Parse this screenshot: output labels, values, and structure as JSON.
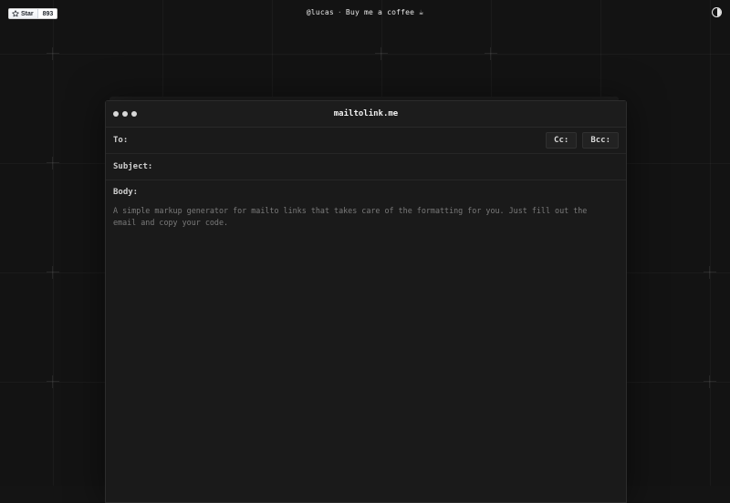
{
  "github": {
    "star_label": "Star",
    "star_count": "893",
    "icon": "star-icon"
  },
  "header": {
    "author": "@lucas",
    "separator": "·",
    "coffee": "Buy me a coffee ☕"
  },
  "theme_toggle": {
    "icon": "contrast-icon"
  },
  "window": {
    "title": "mailtolink.me",
    "to": {
      "label": "To:",
      "value": "",
      "placeholder": ""
    },
    "cc_label": "Cc:",
    "bcc_label": "Bcc:",
    "subject": {
      "label": "Subject:",
      "value": "",
      "placeholder": ""
    },
    "body": {
      "label": "Body:",
      "placeholder": "A simple markup generator for mailto links that takes care of the formatting for you. Just fill out the email and copy your code."
    }
  },
  "colors": {
    "background": "#131313",
    "window": "#1a1a1a",
    "text": "#e6e6e6",
    "muted": "#7a7a7a"
  }
}
